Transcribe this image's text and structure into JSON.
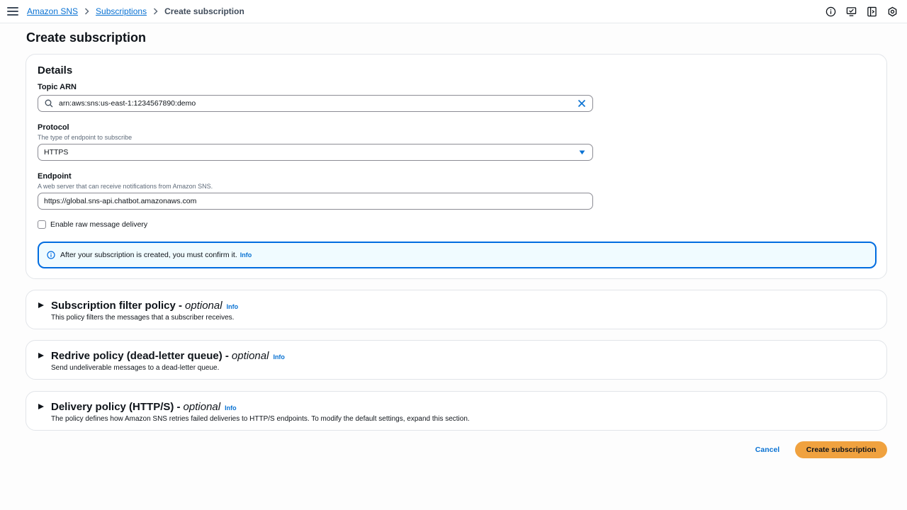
{
  "breadcrumb": {
    "root": "Amazon SNS",
    "parent": "Subscriptions",
    "current": "Create subscription"
  },
  "page": {
    "title": "Create subscription"
  },
  "details": {
    "title": "Details",
    "topic_arn": {
      "label": "Topic ARN",
      "value": "arn:aws:sns:us-east-1:1234567890:demo"
    },
    "protocol": {
      "label": "Protocol",
      "description": "The type of endpoint to subscribe",
      "value": "HTTPS"
    },
    "endpoint": {
      "label": "Endpoint",
      "description": "A web server that can receive notifications from Amazon SNS.",
      "value": "https://global.sns-api.chatbot.amazonaws.com"
    },
    "raw_delivery": {
      "label": "Enable raw message delivery",
      "checked": false
    },
    "alert": {
      "text": "After your subscription is created, you must confirm it.",
      "link": "Info"
    }
  },
  "sections": [
    {
      "title": "Subscription filter policy -",
      "optional": "optional",
      "info": "Info",
      "description": "This policy filters the messages that a subscriber receives."
    },
    {
      "title": "Redrive policy (dead-letter queue) -",
      "optional": "optional",
      "info": "Info",
      "description": "Send undeliverable messages to a dead-letter queue."
    },
    {
      "title": "Delivery policy (HTTP/S) -",
      "optional": "optional",
      "info": "Info",
      "description": "The policy defines how Amazon SNS retries failed deliveries to HTTP/S endpoints. To modify the default settings, expand this section."
    }
  ],
  "actions": {
    "cancel": "Cancel",
    "create": "Create subscription"
  },
  "colors": {
    "link": "#0972d3",
    "primary_button": "#f0a23f",
    "alert_border": "#006ce0",
    "alert_bg": "#f0fbff"
  },
  "icons": {
    "menu": "hamburger-menu-icon",
    "top_bar": [
      "info-circle-icon",
      "screen-share-icon",
      "side-panel-icon",
      "settings-gear-icon"
    ],
    "topic_search": "search-icon",
    "topic_clear": "close-icon",
    "protocol_caret": "caret-down-icon",
    "alert": "info-circle-icon"
  }
}
